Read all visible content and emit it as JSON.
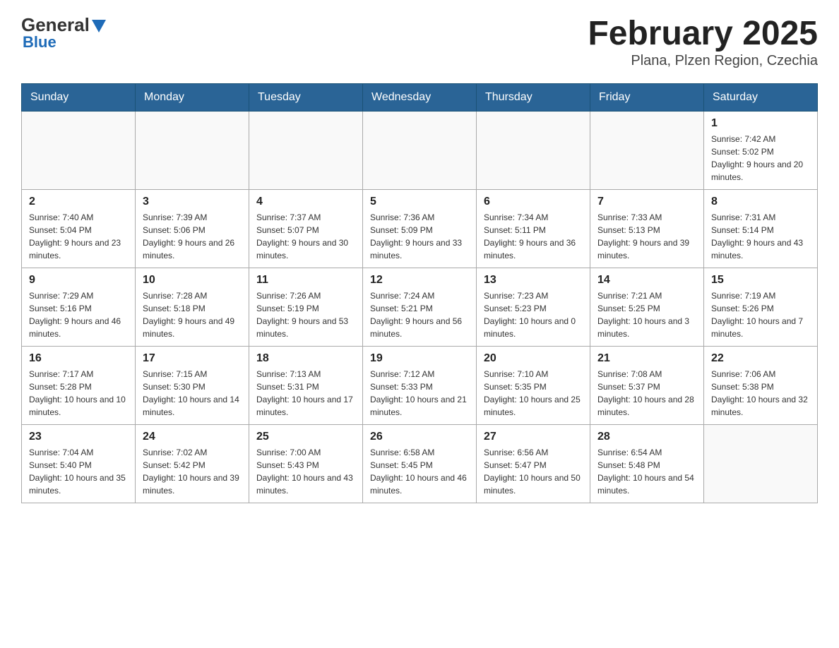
{
  "header": {
    "logo_general": "General",
    "logo_blue": "Blue",
    "title": "February 2025",
    "subtitle": "Plana, Plzen Region, Czechia"
  },
  "days_of_week": [
    "Sunday",
    "Monday",
    "Tuesday",
    "Wednesday",
    "Thursday",
    "Friday",
    "Saturday"
  ],
  "weeks": [
    [
      null,
      null,
      null,
      null,
      null,
      null,
      {
        "day": "1",
        "sunrise": "Sunrise: 7:42 AM",
        "sunset": "Sunset: 5:02 PM",
        "daylight": "Daylight: 9 hours and 20 minutes."
      }
    ],
    [
      {
        "day": "2",
        "sunrise": "Sunrise: 7:40 AM",
        "sunset": "Sunset: 5:04 PM",
        "daylight": "Daylight: 9 hours and 23 minutes."
      },
      {
        "day": "3",
        "sunrise": "Sunrise: 7:39 AM",
        "sunset": "Sunset: 5:06 PM",
        "daylight": "Daylight: 9 hours and 26 minutes."
      },
      {
        "day": "4",
        "sunrise": "Sunrise: 7:37 AM",
        "sunset": "Sunset: 5:07 PM",
        "daylight": "Daylight: 9 hours and 30 minutes."
      },
      {
        "day": "5",
        "sunrise": "Sunrise: 7:36 AM",
        "sunset": "Sunset: 5:09 PM",
        "daylight": "Daylight: 9 hours and 33 minutes."
      },
      {
        "day": "6",
        "sunrise": "Sunrise: 7:34 AM",
        "sunset": "Sunset: 5:11 PM",
        "daylight": "Daylight: 9 hours and 36 minutes."
      },
      {
        "day": "7",
        "sunrise": "Sunrise: 7:33 AM",
        "sunset": "Sunset: 5:13 PM",
        "daylight": "Daylight: 9 hours and 39 minutes."
      },
      {
        "day": "8",
        "sunrise": "Sunrise: 7:31 AM",
        "sunset": "Sunset: 5:14 PM",
        "daylight": "Daylight: 9 hours and 43 minutes."
      }
    ],
    [
      {
        "day": "9",
        "sunrise": "Sunrise: 7:29 AM",
        "sunset": "Sunset: 5:16 PM",
        "daylight": "Daylight: 9 hours and 46 minutes."
      },
      {
        "day": "10",
        "sunrise": "Sunrise: 7:28 AM",
        "sunset": "Sunset: 5:18 PM",
        "daylight": "Daylight: 9 hours and 49 minutes."
      },
      {
        "day": "11",
        "sunrise": "Sunrise: 7:26 AM",
        "sunset": "Sunset: 5:19 PM",
        "daylight": "Daylight: 9 hours and 53 minutes."
      },
      {
        "day": "12",
        "sunrise": "Sunrise: 7:24 AM",
        "sunset": "Sunset: 5:21 PM",
        "daylight": "Daylight: 9 hours and 56 minutes."
      },
      {
        "day": "13",
        "sunrise": "Sunrise: 7:23 AM",
        "sunset": "Sunset: 5:23 PM",
        "daylight": "Daylight: 10 hours and 0 minutes."
      },
      {
        "day": "14",
        "sunrise": "Sunrise: 7:21 AM",
        "sunset": "Sunset: 5:25 PM",
        "daylight": "Daylight: 10 hours and 3 minutes."
      },
      {
        "day": "15",
        "sunrise": "Sunrise: 7:19 AM",
        "sunset": "Sunset: 5:26 PM",
        "daylight": "Daylight: 10 hours and 7 minutes."
      }
    ],
    [
      {
        "day": "16",
        "sunrise": "Sunrise: 7:17 AM",
        "sunset": "Sunset: 5:28 PM",
        "daylight": "Daylight: 10 hours and 10 minutes."
      },
      {
        "day": "17",
        "sunrise": "Sunrise: 7:15 AM",
        "sunset": "Sunset: 5:30 PM",
        "daylight": "Daylight: 10 hours and 14 minutes."
      },
      {
        "day": "18",
        "sunrise": "Sunrise: 7:13 AM",
        "sunset": "Sunset: 5:31 PM",
        "daylight": "Daylight: 10 hours and 17 minutes."
      },
      {
        "day": "19",
        "sunrise": "Sunrise: 7:12 AM",
        "sunset": "Sunset: 5:33 PM",
        "daylight": "Daylight: 10 hours and 21 minutes."
      },
      {
        "day": "20",
        "sunrise": "Sunrise: 7:10 AM",
        "sunset": "Sunset: 5:35 PM",
        "daylight": "Daylight: 10 hours and 25 minutes."
      },
      {
        "day": "21",
        "sunrise": "Sunrise: 7:08 AM",
        "sunset": "Sunset: 5:37 PM",
        "daylight": "Daylight: 10 hours and 28 minutes."
      },
      {
        "day": "22",
        "sunrise": "Sunrise: 7:06 AM",
        "sunset": "Sunset: 5:38 PM",
        "daylight": "Daylight: 10 hours and 32 minutes."
      }
    ],
    [
      {
        "day": "23",
        "sunrise": "Sunrise: 7:04 AM",
        "sunset": "Sunset: 5:40 PM",
        "daylight": "Daylight: 10 hours and 35 minutes."
      },
      {
        "day": "24",
        "sunrise": "Sunrise: 7:02 AM",
        "sunset": "Sunset: 5:42 PM",
        "daylight": "Daylight: 10 hours and 39 minutes."
      },
      {
        "day": "25",
        "sunrise": "Sunrise: 7:00 AM",
        "sunset": "Sunset: 5:43 PM",
        "daylight": "Daylight: 10 hours and 43 minutes."
      },
      {
        "day": "26",
        "sunrise": "Sunrise: 6:58 AM",
        "sunset": "Sunset: 5:45 PM",
        "daylight": "Daylight: 10 hours and 46 minutes."
      },
      {
        "day": "27",
        "sunrise": "Sunrise: 6:56 AM",
        "sunset": "Sunset: 5:47 PM",
        "daylight": "Daylight: 10 hours and 50 minutes."
      },
      {
        "day": "28",
        "sunrise": "Sunrise: 6:54 AM",
        "sunset": "Sunset: 5:48 PM",
        "daylight": "Daylight: 10 hours and 54 minutes."
      },
      null
    ]
  ]
}
